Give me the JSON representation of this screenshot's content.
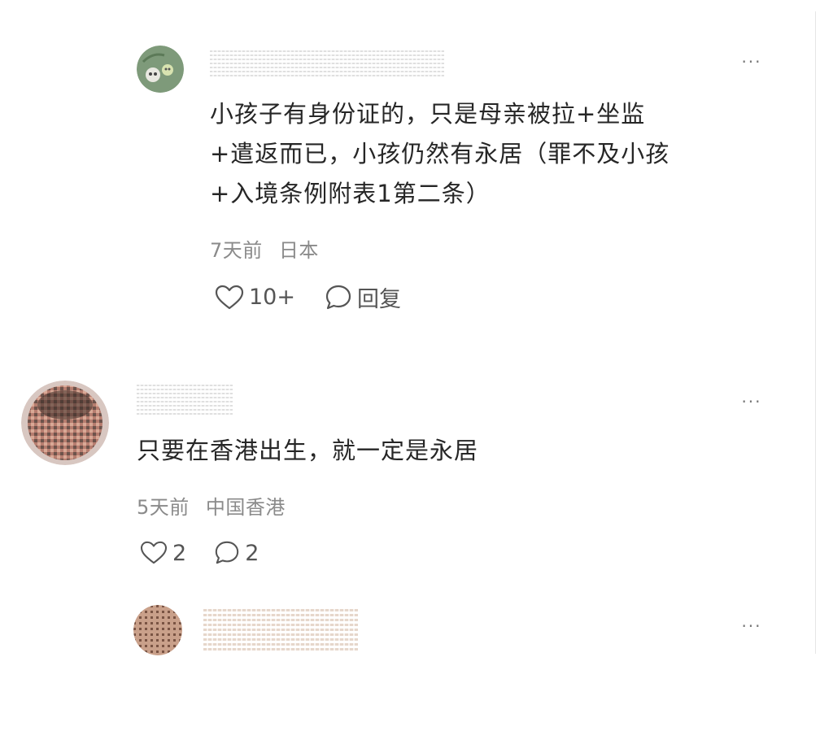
{
  "comments": [
    {
      "text": "小孩子有身份证的，只是母亲被拉+坐监\n+遣返而已，小孩仍然有永居（罪不及小孩\n+入境条例附表1第二条）",
      "time": "7天前",
      "location": "日本",
      "likes": "10+",
      "reply_label": "回复",
      "more_label": "···"
    },
    {
      "text": "只要在香港出生，就一定是永居",
      "time": "5天前",
      "location": "中国香港",
      "likes": "2",
      "replies": "2",
      "more_label": "···"
    },
    {
      "more_label": "···"
    }
  ],
  "icons": {
    "like": "heart-outline-icon",
    "reply": "speech-bubble-outline-icon",
    "more": "ellipsis-icon"
  },
  "colors": {
    "text": "#262626",
    "meta": "#8a8a8a",
    "action": "#555555"
  }
}
